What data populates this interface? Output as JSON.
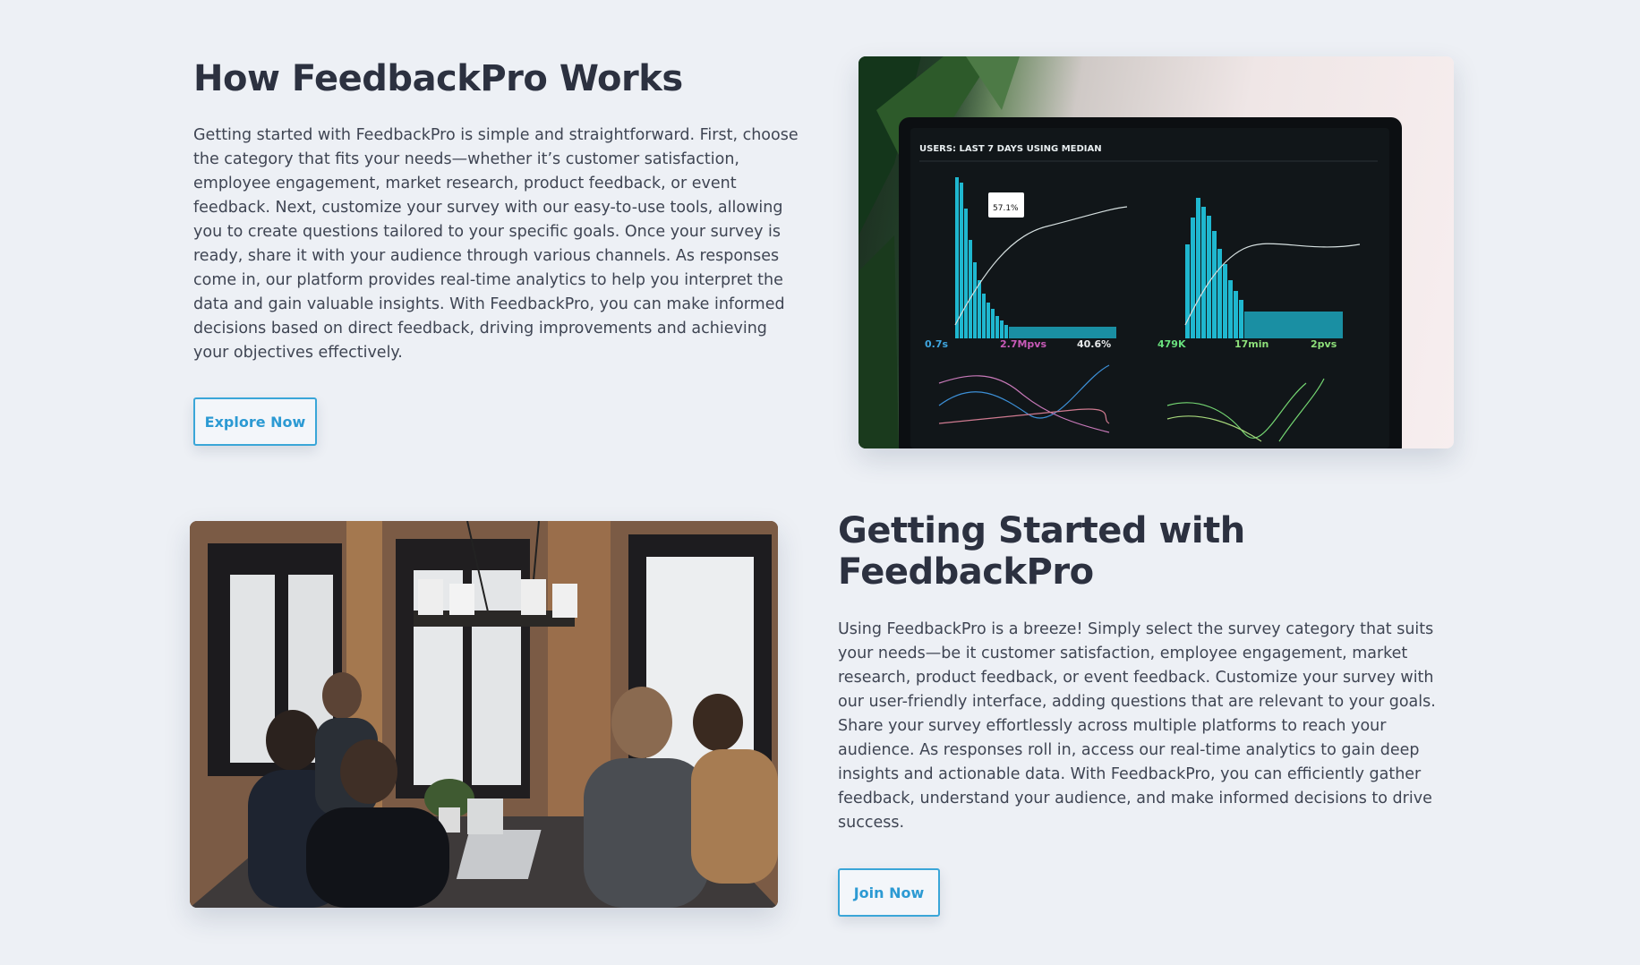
{
  "section1": {
    "title": "How FeedbackPro Works",
    "body": "Getting started with FeedbackPro is simple and straightforward. First, choose the category that fits your needs—whether it’s customer satisfaction, employee engagement, market research, product feedback, or event feedback. Next, customize your survey with our easy-to-use tools, allowing you to create questions tailored to your specific goals. Once your survey is ready, share it with your audience through various channels. As responses come in, our platform provides real-time analytics to help you interpret the data and gain valuable insights. With FeedbackPro, you can make informed decisions based on direct feedback, driving improvements and achieving your objectives effectively.",
    "button_label": "Explore Now"
  },
  "section2": {
    "title": "Getting Started with FeedbackPro",
    "body": "Using FeedbackPro is a breeze! Simply select the survey category that suits your needs—be it customer satisfaction, employee engagement, market research, product feedback, or event feedback. Customize your survey with our user-friendly interface, adding questions that are relevant to your goals. Share your survey effortlessly across multiple platforms to reach your audience. As responses roll in, access our real-time analytics to gain deep insights and actionable data. With FeedbackPro, you can efficiently gather feedback, understand your audience, and make informed decisions to drive success.",
    "button_label": "Join Now"
  },
  "dashboard_image": {
    "header": "USERS: LAST 7 DAYS USING MEDIAN",
    "tooltip": "57.1%",
    "stats": [
      "0.7s",
      "2.7Mpvs",
      "40.6%",
      "479K",
      "17min",
      "2pvs"
    ]
  },
  "colors": {
    "accent": "#3aa6d8",
    "background": "#edf0f5",
    "heading": "#2c3140"
  }
}
